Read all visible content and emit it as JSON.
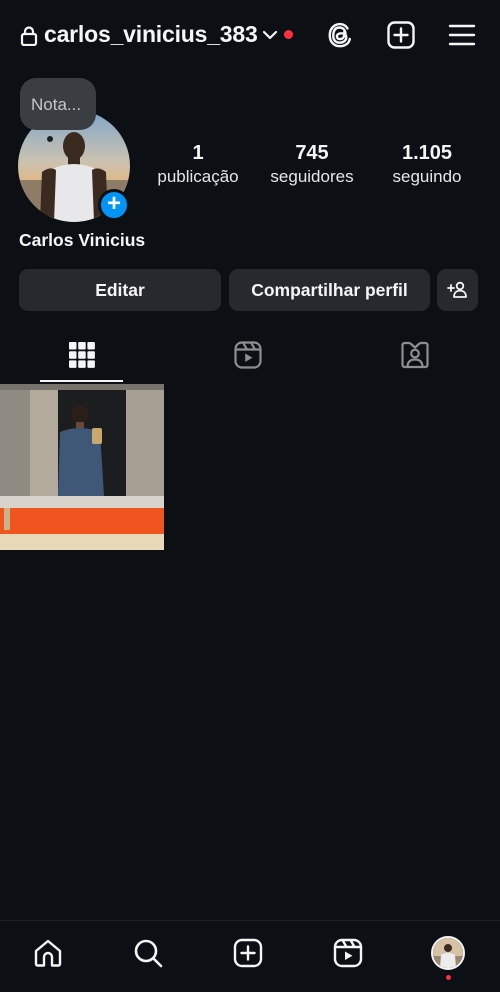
{
  "header": {
    "username": "carlos_vinicius_383",
    "icons": [
      "lock-icon",
      "chevron-down-icon",
      "threads-icon",
      "create-icon",
      "menu-icon"
    ]
  },
  "profile": {
    "note_placeholder": "Nota...",
    "full_name": "Carlos Vinicius",
    "stats": [
      {
        "value": "1",
        "label": "publicação"
      },
      {
        "value": "745",
        "label": "seguidores"
      },
      {
        "value": "1.105",
        "label": "seguindo"
      }
    ],
    "add_story_symbol": "+"
  },
  "actions": {
    "edit_label": "Editar",
    "share_label": "Compartilhar perfil"
  },
  "tabs": [
    "grid-icon",
    "reels-icon",
    "tagged-icon"
  ],
  "posts_count": 1,
  "bottom_nav": [
    "home-icon",
    "search-icon",
    "create-icon",
    "reels-icon",
    "profile-avatar"
  ],
  "colors": {
    "background": "#0c1014",
    "button": "#262a2f",
    "accent_blue": "#0095f6",
    "notification_red": "#ff3040"
  }
}
